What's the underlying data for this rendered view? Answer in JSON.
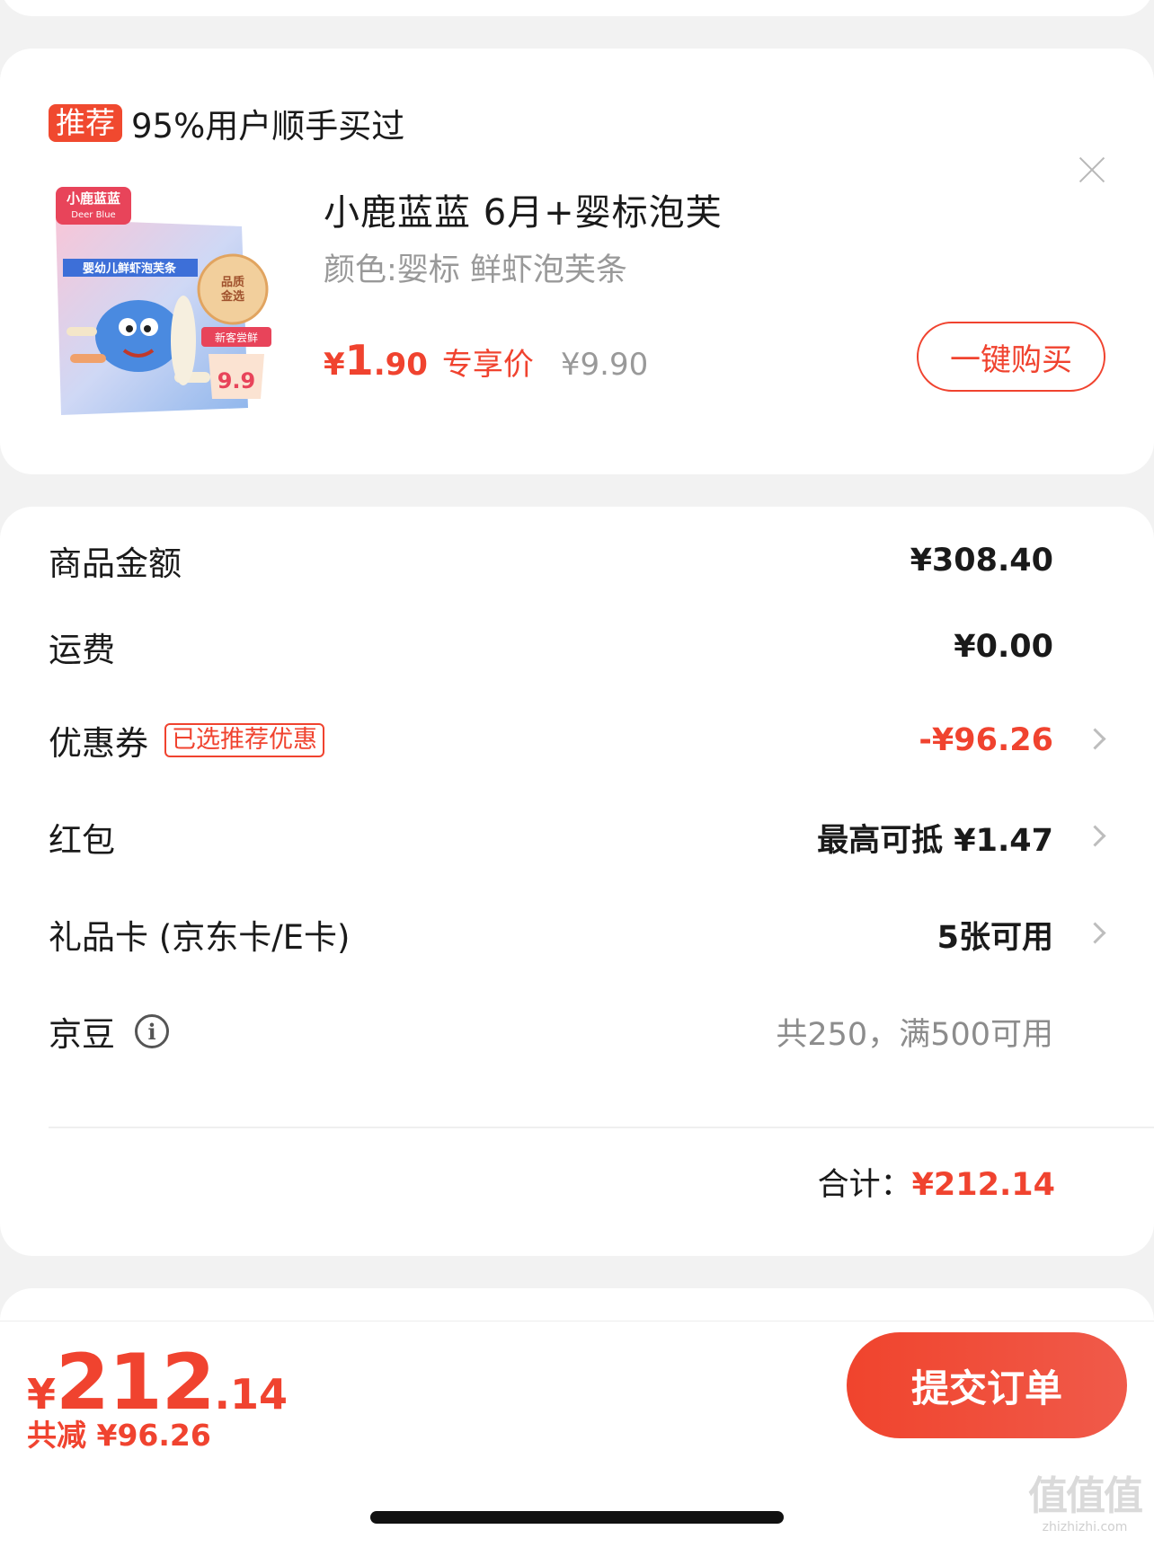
{
  "recommend": {
    "badge": "推荐",
    "title": "95%用户顺手买过",
    "product": {
      "name": "小鹿蓝蓝 6月+婴标泡芙",
      "spec": "颜色:婴标 鲜虾泡芙条",
      "price_symbol": "¥",
      "price_int": "1",
      "price_dec": ".90",
      "price_tag": "专享价",
      "original_price": "¥9.90",
      "buy_button": "一键购买",
      "image_brand": "小鹿蓝蓝",
      "image_brand_en": "Deer Blue",
      "image_label": "婴幼儿鲜虾泡芙条",
      "image_badge": "品质金选",
      "image_new": "新客尝鲜",
      "image_price": "9.9"
    }
  },
  "summary": {
    "rows": [
      {
        "label": "商品金额",
        "value": "¥308.40"
      },
      {
        "label": "运费",
        "value": "¥0.00"
      },
      {
        "label": "优惠券",
        "tag": "已选推荐优惠",
        "value": "-¥96.26"
      },
      {
        "label": "红包",
        "value": "最高可抵 ¥1.47"
      },
      {
        "label": "礼品卡 (京东卡/E卡)",
        "value": "5张可用"
      },
      {
        "label": "京豆",
        "value": "共250，满500可用"
      }
    ],
    "total_label": "合计：",
    "total_value": "¥212.14"
  },
  "bottom": {
    "yen": "¥",
    "int": "212",
    "dec": ".14",
    "saved": "共减 ¥96.26",
    "submit": "提交订单"
  },
  "watermark": {
    "glyphs": "值值值",
    "site": "zhizhizhi.com"
  },
  "colors": {
    "accent": "#f0432f",
    "muted": "#999999",
    "background": "#f2f2f2"
  },
  "icons": [
    "close-icon",
    "chevron-right-icon",
    "info-icon"
  ]
}
